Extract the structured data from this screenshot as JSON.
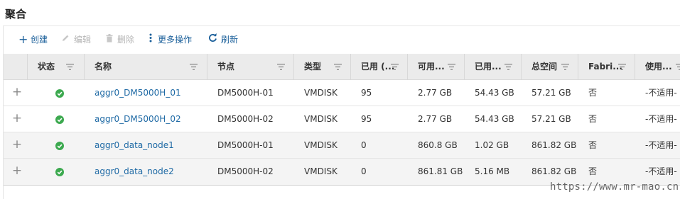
{
  "page": {
    "title": "聚合"
  },
  "toolbar": {
    "create": "创建",
    "edit": "编辑",
    "delete": "删除",
    "more": "更多操作",
    "refresh": "刷新"
  },
  "table": {
    "columns": [
      "状态",
      "名称",
      "节点",
      "类型",
      "已用 (...",
      "可用...",
      "已用...",
      "总空间",
      "Fabri...",
      "使用..."
    ],
    "rows": [
      {
        "status": "online",
        "name": "aggr0_DM5000H_01",
        "node": "DM5000H-01",
        "type": "VMDISK",
        "used_pct": "95",
        "available": "2.77 GB",
        "used": "54.43 GB",
        "total": "57.21 GB",
        "fabric": "否",
        "usage": "-不适用-"
      },
      {
        "status": "online",
        "name": "aggr0_DM5000H_02",
        "node": "DM5000H-02",
        "type": "VMDISK",
        "used_pct": "95",
        "available": "2.77 GB",
        "used": "54.43 GB",
        "total": "57.21 GB",
        "fabric": "否",
        "usage": "-不适用-"
      },
      {
        "status": "online",
        "name": "aggr0_data_node1",
        "node": "DM5000H-01",
        "type": "VMDISK",
        "used_pct": "0",
        "available": "860.8 GB",
        "used": "1.02 GB",
        "total": "861.82 GB",
        "fabric": "否",
        "usage": "-不适用-"
      },
      {
        "status": "online",
        "name": "aggr0_data_node2",
        "node": "DM5000H-02",
        "type": "VMDISK",
        "used_pct": "0",
        "available": "861.81 GB",
        "used": "5.16 MB",
        "total": "861.82 GB",
        "fabric": "否",
        "usage": "-不适用-"
      }
    ]
  },
  "watermark": "https://www.mr-mao.cn",
  "colors": {
    "link": "#1f6aa5",
    "status_ok": "#3ca94f",
    "header_bg": "#ebebeb",
    "toolbar_text": "#1a5f9a"
  }
}
